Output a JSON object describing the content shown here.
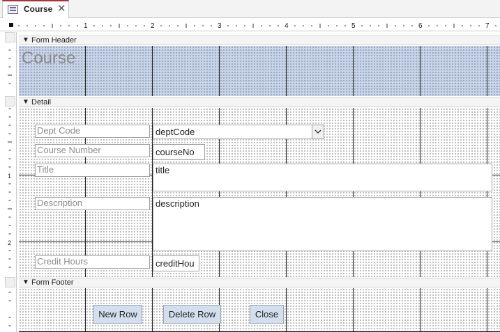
{
  "tab": {
    "label": "Course",
    "icon": "form-icon",
    "close_icon": "close-icon",
    "close_glyph": "✕",
    "accent": "#a4373a"
  },
  "ruler": {
    "marks": [
      "1",
      "2",
      "3",
      "4",
      "5",
      "6",
      "7"
    ],
    "left_marks": [
      "1",
      "2"
    ]
  },
  "sections": {
    "header": {
      "label": "Form Header",
      "color": "#c7d5ec"
    },
    "detail": {
      "label": "Detail"
    },
    "footer": {
      "label": "Form Footer"
    }
  },
  "form_header": {
    "title": "Course"
  },
  "detail": {
    "dept_code": {
      "label": "Dept Code",
      "value": "deptCode"
    },
    "course_number": {
      "label": "Course Number",
      "value": "courseNo"
    },
    "title": {
      "label": "Title",
      "value": "title"
    },
    "description": {
      "label": "Description",
      "value": "description"
    },
    "credit_hours": {
      "label": "Credit Hours",
      "value": "creditHou"
    }
  },
  "form_footer": {
    "new_row": "New Row",
    "delete_row": "Delete Row",
    "close": "Close",
    "button_color": "#d3dfef"
  }
}
